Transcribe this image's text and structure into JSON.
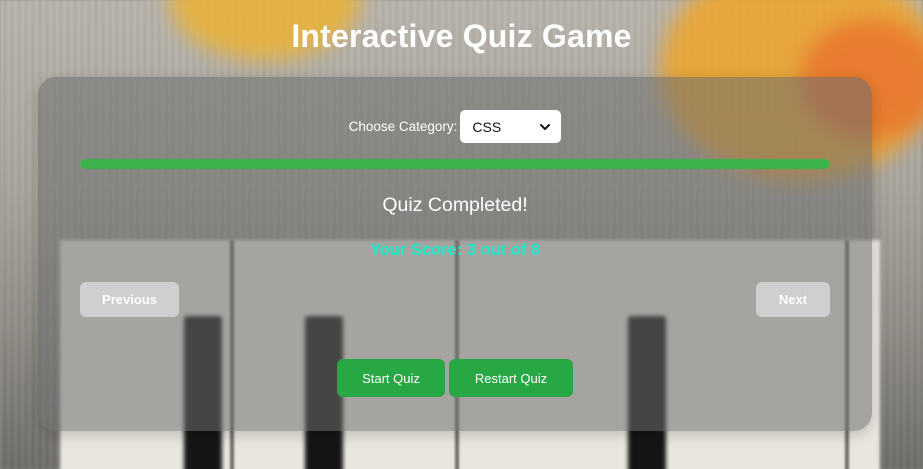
{
  "header": {
    "title": "Interactive Quiz Game"
  },
  "category": {
    "label": "Choose Category:",
    "selected": "CSS",
    "icon": "chevron-down-icon"
  },
  "progress": {
    "fraction": 1.0,
    "color": "#3cb34a"
  },
  "quiz": {
    "status": "Quiz Completed!",
    "score_text": "Your Score: 3 out of 8",
    "score_color": "#1de9c9"
  },
  "navigation": {
    "previous_label": "Previous",
    "next_label": "Next"
  },
  "actions": {
    "start_label": "Start Quiz",
    "restart_label": "Restart Quiz",
    "button_color": "#28a745"
  }
}
